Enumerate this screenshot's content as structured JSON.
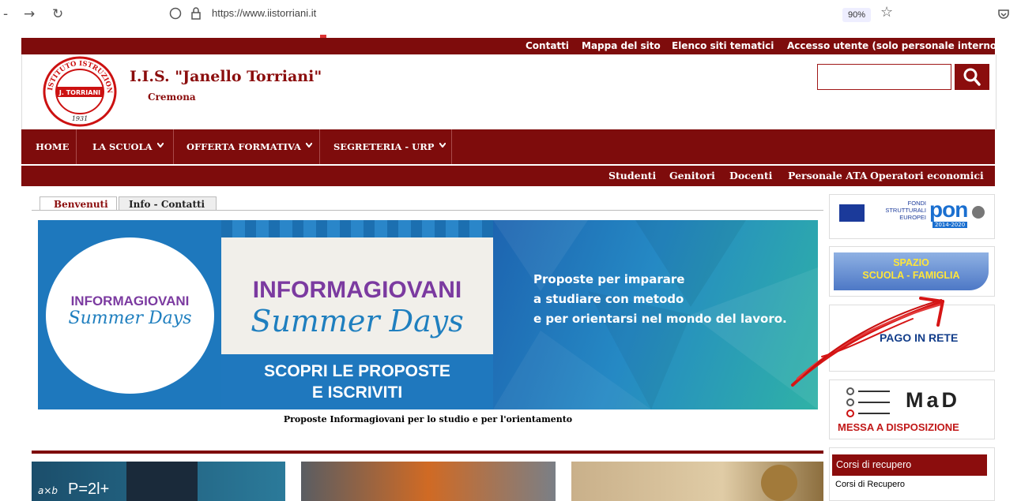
{
  "browser": {
    "url": "https://www.iistorriani.it",
    "zoom": "90%"
  },
  "topbar": {
    "links": [
      "Contatti",
      "Mappa del sito",
      "Elenco siti tematici",
      "Accesso utente (solo personale interno)"
    ]
  },
  "header": {
    "name": "I.I.S. \"Janello Torriani\"",
    "city": "Cremona",
    "logo_text": {
      "ring": "ISTITUTO ISTRUZIONE SUPERIORE",
      "center": "J. TORRIANI",
      "year": "1931"
    }
  },
  "mainnav": {
    "items": [
      "HOME",
      "LA SCUOLA",
      "OFFERTA FORMATIVA",
      "SEGRETERIA - URP"
    ]
  },
  "secnav": {
    "links": [
      "Studenti",
      "Genitori",
      "Docenti",
      "Personale ATA",
      "Operatori economici"
    ]
  },
  "tabs": [
    "Benvenuti",
    "Info - Contatti"
  ],
  "banner": {
    "circle_title": "INFORMAGIOVANI",
    "circle_script": "Summer Days",
    "mid_title": "INFORMAGIOVANI",
    "mid_script": "Summer Days",
    "mid_cta_1": "SCOPRI LE PROPOSTE",
    "mid_cta_2": "E ISCRIVITI",
    "right_text": [
      "Proposte per imparare",
      "a studiare con metodo",
      "e per orientarsi nel mondo del lavoro."
    ],
    "caption": "Proposte Informagiovani per lo studio e per l'orientamento"
  },
  "sidebar": {
    "pon": {
      "line1": "FONDI",
      "line2": "STRUTTURALI",
      "line3": "EUROPEI",
      "brand": "PON",
      "years": "2014-2020"
    },
    "famiglia": {
      "line1": "SPAZIO",
      "line2": "SCUOLA - FAMIGLIA"
    },
    "pago": "PAGO IN RETE",
    "mad": {
      "title": "MaD",
      "subtitle": "MESSA A DISPOSIZIONE"
    },
    "corsi": {
      "header": "Corsi di recupero",
      "link": "Corsi di Recupero"
    }
  },
  "bottom_thumbs": {
    "formula": "P=2l+"
  },
  "colors": {
    "brand": "#7e0c0c",
    "banner_blue": "#1f7fbf",
    "banner_teal": "#27a9a0",
    "purple": "#7b3aa0",
    "annotation_red": "#d61515"
  }
}
